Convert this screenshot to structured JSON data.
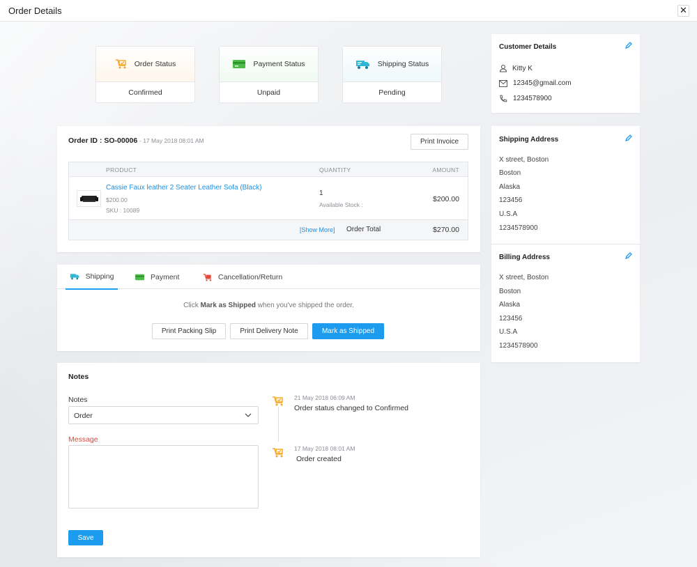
{
  "window": {
    "title": "Order Details",
    "close_symbol": "✕"
  },
  "status_cards": [
    {
      "label": "Order Status",
      "value": "Confirmed",
      "icon": "cart-check-icon",
      "color": "#f5a623"
    },
    {
      "label": "Payment Status",
      "value": "Unpaid",
      "icon": "credit-card-icon",
      "color": "#4cbb47"
    },
    {
      "label": "Shipping Status",
      "value": "Pending",
      "icon": "delivery-truck-icon",
      "color": "#2fb6d6"
    }
  ],
  "order": {
    "id_label": "Order ID : SO-00006",
    "date": "- 17 May 2018 08:01 AM",
    "print_invoice": "Print Invoice",
    "columns": {
      "product": "PRODUCT",
      "quantity": "QUANTITY",
      "amount": "AMOUNT"
    },
    "item": {
      "name": "Cassie Faux leather 2 Seater Leather Sofa (Black)",
      "price": "$200.00",
      "sku": "SKU : 10089",
      "quantity": "1",
      "stock": "Available Stock :",
      "amount": "$200.00"
    },
    "show_more": "[Show More]",
    "total_label": "Order Total",
    "total_value": "$270.00"
  },
  "tabs": [
    {
      "label": "Shipping",
      "icon": "truck-icon",
      "active": true
    },
    {
      "label": "Payment",
      "icon": "card-icon",
      "active": false
    },
    {
      "label": "Cancellation/Return",
      "icon": "cart-return-icon",
      "active": false
    }
  ],
  "shipping": {
    "hint_prefix": "Click ",
    "hint_bold": "Mark as Shipped",
    "hint_suffix": " when you've shipped the order.",
    "buttons": {
      "packing": "Print Packing Slip",
      "delivery": "Print Delivery Note",
      "ship": "Mark as Shipped"
    }
  },
  "notes": {
    "title": "Notes",
    "notes_label": "Notes",
    "notes_value": "Order",
    "message_label": "Message",
    "message_value": "",
    "save": "Save"
  },
  "timeline": [
    {
      "date": "21 May 2018 06:09 AM",
      "text": "Order status changed to Confirmed"
    },
    {
      "date": "17 May 2018 08:01 AM",
      "text": "Order created"
    }
  ],
  "customer": {
    "title": "Customer Details",
    "name": "Kitty K",
    "email": "12345@gmail.com",
    "phone": "1234578900"
  },
  "shipping_address": {
    "title": "Shipping Address",
    "lines": [
      "X street, Boston",
      "Boston",
      "Alaska",
      "123456",
      "U.S.A",
      "1234578900"
    ]
  },
  "billing_address": {
    "title": "Billing Address",
    "lines": [
      "X street, Boston",
      "Boston",
      "Alaska",
      "123456",
      "U.S.A",
      "1234578900"
    ]
  }
}
